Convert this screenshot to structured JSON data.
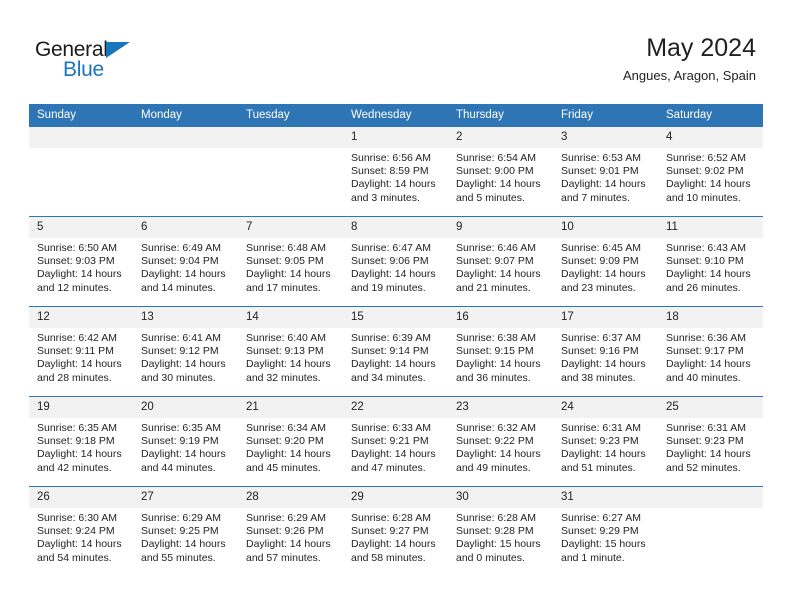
{
  "brand": {
    "name_top": "General",
    "name_bottom": "Blue",
    "accent_color": "#1b75bb"
  },
  "header": {
    "title": "May 2024",
    "subtitle": "Angues, Aragon, Spain"
  },
  "theme": {
    "header_bg": "#2e75b6",
    "daynum_bg": "#f2f2f2",
    "text": "#231f20"
  },
  "weekday_headers": [
    "Sunday",
    "Monday",
    "Tuesday",
    "Wednesday",
    "Thursday",
    "Friday",
    "Saturday"
  ],
  "weeks": [
    [
      {
        "day": "",
        "empty": true
      },
      {
        "day": "",
        "empty": true
      },
      {
        "day": "",
        "empty": true
      },
      {
        "day": "1",
        "sunrise": "Sunrise: 6:56 AM",
        "sunset": "Sunset: 8:59 PM",
        "daylight": "Daylight: 14 hours and 3 minutes."
      },
      {
        "day": "2",
        "sunrise": "Sunrise: 6:54 AM",
        "sunset": "Sunset: 9:00 PM",
        "daylight": "Daylight: 14 hours and 5 minutes."
      },
      {
        "day": "3",
        "sunrise": "Sunrise: 6:53 AM",
        "sunset": "Sunset: 9:01 PM",
        "daylight": "Daylight: 14 hours and 7 minutes."
      },
      {
        "day": "4",
        "sunrise": "Sunrise: 6:52 AM",
        "sunset": "Sunset: 9:02 PM",
        "daylight": "Daylight: 14 hours and 10 minutes."
      }
    ],
    [
      {
        "day": "5",
        "sunrise": "Sunrise: 6:50 AM",
        "sunset": "Sunset: 9:03 PM",
        "daylight": "Daylight: 14 hours and 12 minutes."
      },
      {
        "day": "6",
        "sunrise": "Sunrise: 6:49 AM",
        "sunset": "Sunset: 9:04 PM",
        "daylight": "Daylight: 14 hours and 14 minutes."
      },
      {
        "day": "7",
        "sunrise": "Sunrise: 6:48 AM",
        "sunset": "Sunset: 9:05 PM",
        "daylight": "Daylight: 14 hours and 17 minutes."
      },
      {
        "day": "8",
        "sunrise": "Sunrise: 6:47 AM",
        "sunset": "Sunset: 9:06 PM",
        "daylight": "Daylight: 14 hours and 19 minutes."
      },
      {
        "day": "9",
        "sunrise": "Sunrise: 6:46 AM",
        "sunset": "Sunset: 9:07 PM",
        "daylight": "Daylight: 14 hours and 21 minutes."
      },
      {
        "day": "10",
        "sunrise": "Sunrise: 6:45 AM",
        "sunset": "Sunset: 9:09 PM",
        "daylight": "Daylight: 14 hours and 23 minutes."
      },
      {
        "day": "11",
        "sunrise": "Sunrise: 6:43 AM",
        "sunset": "Sunset: 9:10 PM",
        "daylight": "Daylight: 14 hours and 26 minutes."
      }
    ],
    [
      {
        "day": "12",
        "sunrise": "Sunrise: 6:42 AM",
        "sunset": "Sunset: 9:11 PM",
        "daylight": "Daylight: 14 hours and 28 minutes."
      },
      {
        "day": "13",
        "sunrise": "Sunrise: 6:41 AM",
        "sunset": "Sunset: 9:12 PM",
        "daylight": "Daylight: 14 hours and 30 minutes."
      },
      {
        "day": "14",
        "sunrise": "Sunrise: 6:40 AM",
        "sunset": "Sunset: 9:13 PM",
        "daylight": "Daylight: 14 hours and 32 minutes."
      },
      {
        "day": "15",
        "sunrise": "Sunrise: 6:39 AM",
        "sunset": "Sunset: 9:14 PM",
        "daylight": "Daylight: 14 hours and 34 minutes."
      },
      {
        "day": "16",
        "sunrise": "Sunrise: 6:38 AM",
        "sunset": "Sunset: 9:15 PM",
        "daylight": "Daylight: 14 hours and 36 minutes."
      },
      {
        "day": "17",
        "sunrise": "Sunrise: 6:37 AM",
        "sunset": "Sunset: 9:16 PM",
        "daylight": "Daylight: 14 hours and 38 minutes."
      },
      {
        "day": "18",
        "sunrise": "Sunrise: 6:36 AM",
        "sunset": "Sunset: 9:17 PM",
        "daylight": "Daylight: 14 hours and 40 minutes."
      }
    ],
    [
      {
        "day": "19",
        "sunrise": "Sunrise: 6:35 AM",
        "sunset": "Sunset: 9:18 PM",
        "daylight": "Daylight: 14 hours and 42 minutes."
      },
      {
        "day": "20",
        "sunrise": "Sunrise: 6:35 AM",
        "sunset": "Sunset: 9:19 PM",
        "daylight": "Daylight: 14 hours and 44 minutes."
      },
      {
        "day": "21",
        "sunrise": "Sunrise: 6:34 AM",
        "sunset": "Sunset: 9:20 PM",
        "daylight": "Daylight: 14 hours and 45 minutes."
      },
      {
        "day": "22",
        "sunrise": "Sunrise: 6:33 AM",
        "sunset": "Sunset: 9:21 PM",
        "daylight": "Daylight: 14 hours and 47 minutes."
      },
      {
        "day": "23",
        "sunrise": "Sunrise: 6:32 AM",
        "sunset": "Sunset: 9:22 PM",
        "daylight": "Daylight: 14 hours and 49 minutes."
      },
      {
        "day": "24",
        "sunrise": "Sunrise: 6:31 AM",
        "sunset": "Sunset: 9:23 PM",
        "daylight": "Daylight: 14 hours and 51 minutes."
      },
      {
        "day": "25",
        "sunrise": "Sunrise: 6:31 AM",
        "sunset": "Sunset: 9:23 PM",
        "daylight": "Daylight: 14 hours and 52 minutes."
      }
    ],
    [
      {
        "day": "26",
        "sunrise": "Sunrise: 6:30 AM",
        "sunset": "Sunset: 9:24 PM",
        "daylight": "Daylight: 14 hours and 54 minutes."
      },
      {
        "day": "27",
        "sunrise": "Sunrise: 6:29 AM",
        "sunset": "Sunset: 9:25 PM",
        "daylight": "Daylight: 14 hours and 55 minutes."
      },
      {
        "day": "28",
        "sunrise": "Sunrise: 6:29 AM",
        "sunset": "Sunset: 9:26 PM",
        "daylight": "Daylight: 14 hours and 57 minutes."
      },
      {
        "day": "29",
        "sunrise": "Sunrise: 6:28 AM",
        "sunset": "Sunset: 9:27 PM",
        "daylight": "Daylight: 14 hours and 58 minutes."
      },
      {
        "day": "30",
        "sunrise": "Sunrise: 6:28 AM",
        "sunset": "Sunset: 9:28 PM",
        "daylight": "Daylight: 15 hours and 0 minutes."
      },
      {
        "day": "31",
        "sunrise": "Sunrise: 6:27 AM",
        "sunset": "Sunset: 9:29 PM",
        "daylight": "Daylight: 15 hours and 1 minute."
      },
      {
        "day": "",
        "empty": true
      }
    ]
  ]
}
